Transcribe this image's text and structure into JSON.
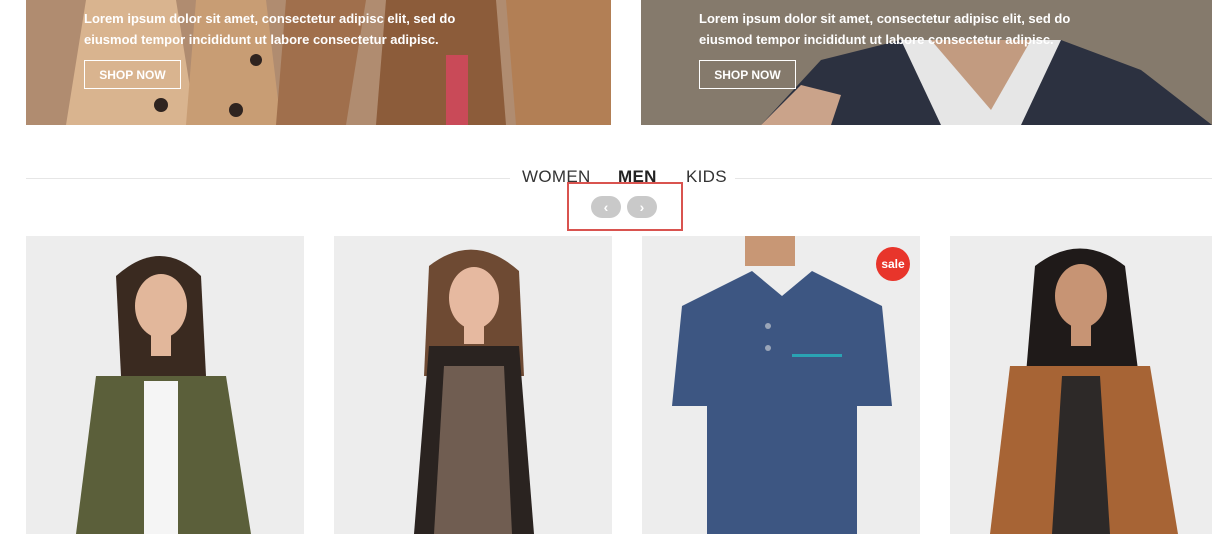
{
  "banners": [
    {
      "text": "Lorem ipsum dolor sit amet, consectetur adipisc elit, sed do eiusmod tempor incididunt ut labore consectetur adipisc.",
      "button_label": "SHOP NOW"
    },
    {
      "text": "Lorem ipsum dolor sit amet, consectetur adipisc elit, sed do eiusmod tempor incididunt ut labore consectetur adipisc.",
      "button_label": "SHOP NOW"
    }
  ],
  "tabs": [
    {
      "label": "WOMEN",
      "active": false
    },
    {
      "label": "MEN",
      "active": true
    },
    {
      "label": "KIDS",
      "active": false
    }
  ],
  "carousel": {
    "prev_icon": "‹",
    "next_icon": "›"
  },
  "products": [
    {
      "image": "woman-olive-cardigan"
    },
    {
      "image": "woman-black-lace-dress"
    },
    {
      "image": "man-navy-polo",
      "badge": "sale"
    },
    {
      "image": "woman-brown-leather-jacket"
    }
  ],
  "colors": {
    "accent_highlight": "#d9534f",
    "sale_badge": "#e8352b"
  }
}
